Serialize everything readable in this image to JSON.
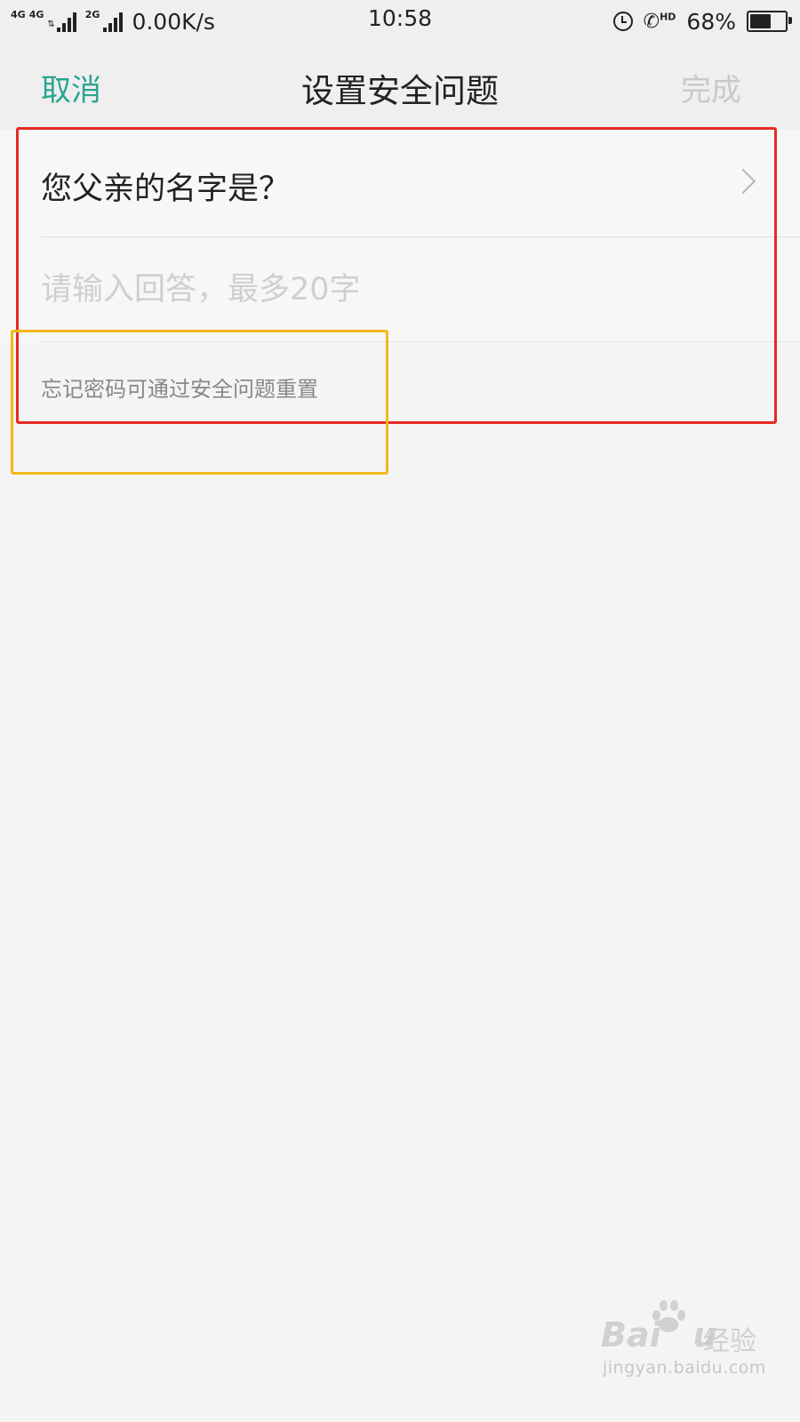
{
  "status_bar": {
    "net1": "4G",
    "net2": "4G",
    "net3": "2G",
    "speed": "0.00K/s",
    "time": "10:58",
    "hd": "HD",
    "battery_percent": "68%",
    "battery_level": 0.68,
    "icons": [
      "signal-icon",
      "alarm-icon",
      "hd-call-icon",
      "battery-icon"
    ]
  },
  "nav": {
    "cancel": "取消",
    "title": "设置安全问题",
    "done": "完成"
  },
  "form": {
    "question": "您父亲的名字是？",
    "answer_value": "",
    "answer_placeholder": "请输入回答，最多20字",
    "hint": "忘记密码可通过安全问题重置"
  },
  "watermark": {
    "brand_left": "Bai",
    "brand_right": "u",
    "brand_cn": "经验",
    "url": "jingyan.baidu.com"
  },
  "colors": {
    "accent": "#2aa58f",
    "disabled": "#c9c9c9",
    "highlight_red": "#e52b22",
    "highlight_yellow": "#f2b91a",
    "background": "#f4f4f4"
  }
}
